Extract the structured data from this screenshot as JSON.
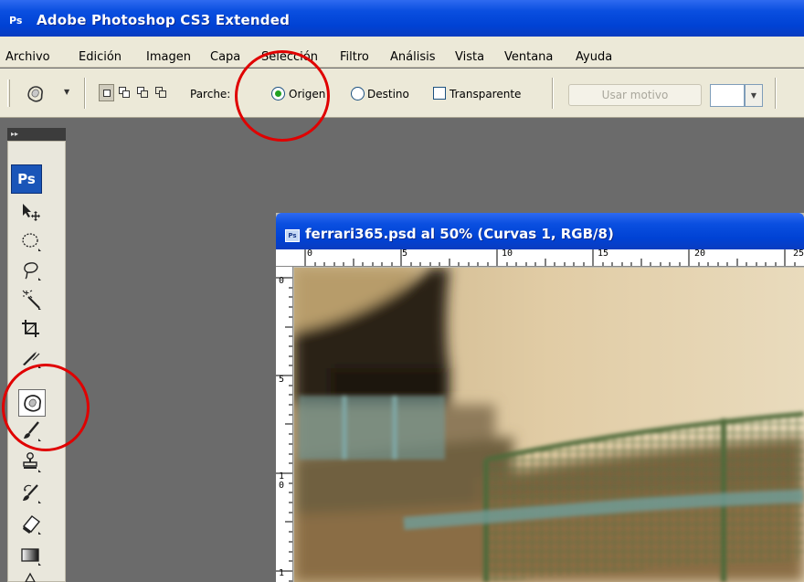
{
  "window": {
    "logo": "Ps",
    "title": "Adobe Photoshop CS3 Extended"
  },
  "menu": [
    {
      "label": "Archivo"
    },
    {
      "label": "Edición"
    },
    {
      "label": "Imagen"
    },
    {
      "label": "Capa"
    },
    {
      "label": "Selección"
    },
    {
      "label": "Filtro"
    },
    {
      "label": "Análisis"
    },
    {
      "label": "Vista"
    },
    {
      "label": "Ventana"
    },
    {
      "label": "Ayuda"
    }
  ],
  "options": {
    "tool_icon": "patch-tool-icon",
    "selection_modes": [
      "new-selection",
      "add-to-selection",
      "subtract-from-selection",
      "intersect-selection"
    ],
    "patch_label": "Parche:",
    "origin_label": "Origen",
    "origin_selected": true,
    "destination_label": "Destino",
    "transparent_label": "Transparente",
    "transparent_checked": false,
    "use_pattern_label": "Usar motivo",
    "use_pattern_enabled": false
  },
  "toolbox": {
    "badge": "Ps",
    "tools": [
      "move-tool-icon",
      "elliptical-marquee-icon",
      "lasso-icon",
      "magic-wand-icon",
      "crop-icon",
      "slice-icon",
      "patch-tool-icon",
      "brush-icon",
      "stamp-icon",
      "history-brush-icon",
      "eraser-icon",
      "gradient-icon",
      "blur-icon"
    ],
    "selected_tool": "patch-tool-icon"
  },
  "document": {
    "title": "ferrari365.psd al 50% (Curvas 1, RGB/8)",
    "ruler_top": [
      "0",
      "5",
      "10",
      "15",
      "20",
      "25"
    ],
    "ruler_left": [
      "0",
      "5",
      "1\n0",
      "1"
    ]
  },
  "colors": {
    "xp_blue": "#0042d4",
    "chrome": "#ece9d8",
    "workspace": "#6b6b6b",
    "annotation": "#e00000"
  }
}
